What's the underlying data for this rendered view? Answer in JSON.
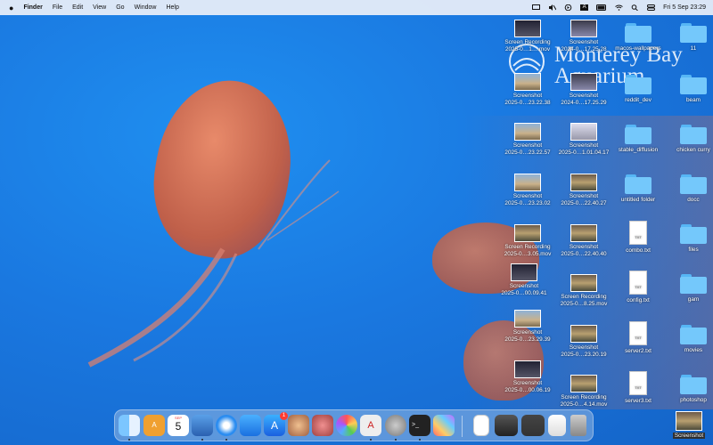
{
  "menubar": {
    "apple": "",
    "app_name": "Finder",
    "items": [
      "File",
      "Edit",
      "View",
      "Go",
      "Window",
      "Help"
    ],
    "datetime": "Fri 5 Sep  23:29"
  },
  "wallpaper_text": [
    "Monterey Bay",
    "Aquarium"
  ],
  "desktop_icons": [
    {
      "label": "Screen Recording\n2025-0…1….mov",
      "kind": "thumb",
      "thumb": "dark"
    },
    {
      "label": "Screenshot\n2024-0…17.25.28",
      "kind": "thumb",
      "thumb": "win"
    },
    {
      "label": "macos-wallpapers",
      "kind": "folder"
    },
    {
      "label": "11",
      "kind": "folder"
    },
    {
      "label": "Screenshot\n2025-0…23.22.38",
      "kind": "thumb",
      "thumb": "beach"
    },
    {
      "label": "Screenshot\n2024-0…17.25.29",
      "kind": "thumb",
      "thumb": "win"
    },
    {
      "label": "reddit_dev",
      "kind": "folder"
    },
    {
      "label": "beam",
      "kind": "folder"
    },
    {
      "label": "Screenshot\n2025-0…23.22.57",
      "kind": "thumb",
      "thumb": "beach"
    },
    {
      "label": "Screenshot\n2025-0…1.01.04.17",
      "kind": "thumb",
      "thumb": "screen"
    },
    {
      "label": "stable_diffusion",
      "kind": "folder"
    },
    {
      "label": "chicken curry",
      "kind": "folder"
    },
    {
      "label": "Screenshot\n2025-0…23.23.02",
      "kind": "thumb",
      "thumb": "beach"
    },
    {
      "label": "Screenshot\n2025-0…22.40.27",
      "kind": "thumb",
      "thumb": "photo"
    },
    {
      "label": "untitled folder",
      "kind": "folder"
    },
    {
      "label": "docc",
      "kind": "folder"
    },
    {
      "label": "Screen Recording\n2025-0…3.05.mov",
      "kind": "thumb",
      "thumb": "photo"
    },
    {
      "label": "Screenshot\n2025-0…22.40.40",
      "kind": "thumb",
      "thumb": "photo"
    },
    {
      "label": "combo.txt",
      "kind": "txt"
    },
    {
      "label": "files",
      "kind": "folder"
    },
    {
      "label": "Screenshot\n2025-0…00.09.41",
      "kind": "thumb",
      "thumb": "dark"
    },
    {
      "label": "Screen Recording\n2025-0…8.25.mov",
      "kind": "thumb",
      "thumb": "photo"
    },
    {
      "label": "config.txt",
      "kind": "txt"
    },
    {
      "label": "gam",
      "kind": "folder"
    },
    {
      "label": "Screenshot\n2025-0…23.29.39",
      "kind": "thumb",
      "thumb": "beach"
    },
    {
      "label": "Screenshot\n2025-0…23.20.19",
      "kind": "thumb",
      "thumb": "photo"
    },
    {
      "label": "server2.txt",
      "kind": "txt"
    },
    {
      "label": "movies",
      "kind": "folder"
    },
    {
      "label": "Screenshot\n2025-0…00.06.19",
      "kind": "thumb",
      "thumb": "dark"
    },
    {
      "label": "Screen Recording\n2025-0…4.14.mov",
      "kind": "thumb",
      "thumb": "photo"
    },
    {
      "label": "server3.txt",
      "kind": "txt"
    },
    {
      "label": "photoshop",
      "kind": "folder"
    },
    {
      "label": "Screenshot",
      "kind": "thumb",
      "thumb": "photo"
    }
  ],
  "dock": {
    "calendar_month": "SEP",
    "calendar_day": "5",
    "appstore_badge": "1",
    "apps": [
      "finder",
      "dictionary",
      "calendar",
      "notes-xcode",
      "safari",
      "mail",
      "app-store",
      "game-1",
      "game-2",
      "photos",
      "font-app",
      "settings",
      "terminal",
      "launchpad",
      "document",
      "screen-1",
      "screen-2",
      "screen-3",
      "trash"
    ]
  },
  "colors": {
    "desktop_blue": "#1a78e0",
    "folder": "#74c8fb"
  }
}
